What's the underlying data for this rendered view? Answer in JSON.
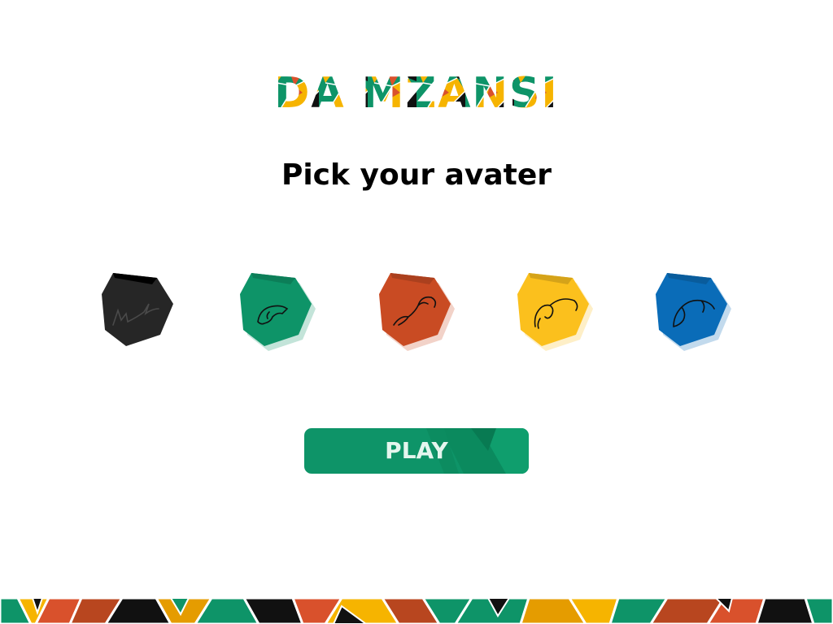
{
  "logo": {
    "text": "DA MZANSI",
    "colors": [
      "#0e9468",
      "#f6b400",
      "#d9512c",
      "#111111"
    ]
  },
  "heading": "Pick your avater",
  "avatars": [
    {
      "name": "rhino",
      "color": "#262626",
      "selected": true
    },
    {
      "name": "leopard",
      "color": "#0e9468",
      "selected": false
    },
    {
      "name": "buffalo",
      "color": "#c94b23",
      "selected": false
    },
    {
      "name": "elephant",
      "color": "#fbc01d",
      "selected": false
    },
    {
      "name": "lion",
      "color": "#0a6cb8",
      "selected": false
    }
  ],
  "play_button": {
    "label": "PLAY",
    "color": "#0e9468"
  },
  "pattern_colors": [
    "#0e9468",
    "#f6b400",
    "#d9512c",
    "#111111",
    "#b8461f",
    "#e59c00"
  ]
}
